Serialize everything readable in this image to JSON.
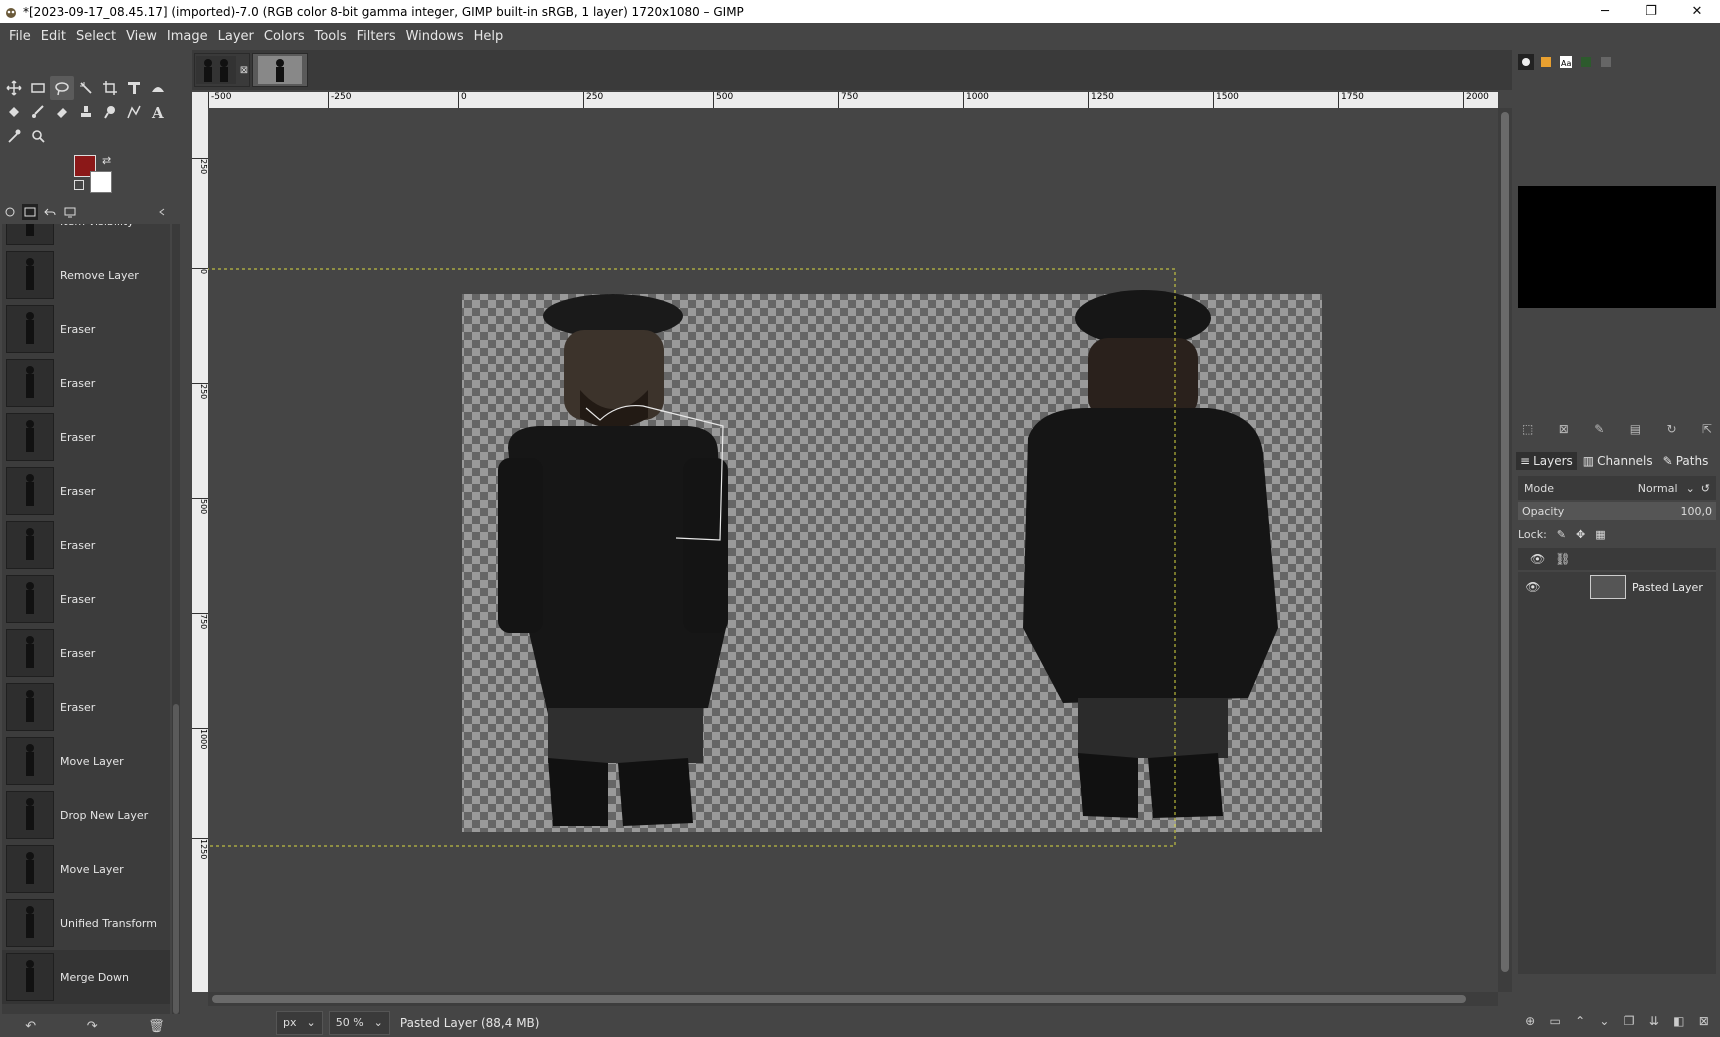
{
  "window": {
    "title": "*[2023-09-17_08.45.17] (imported)-7.0 (RGB color 8-bit gamma integer, GIMP built-in sRGB, 1 layer) 1720x1080 – GIMP",
    "minimize": "─",
    "maximize": "❐",
    "close": "✕"
  },
  "menu": [
    "File",
    "Edit",
    "Select",
    "View",
    "Image",
    "Layer",
    "Colors",
    "Tools",
    "Filters",
    "Windows",
    "Help"
  ],
  "toolbox": {
    "foreground_color": "#8b1818",
    "background_color": "#ffffff",
    "tools": [
      "move-tool-icon",
      "rect-select-icon",
      "free-select-icon",
      "fuzzy-select-icon",
      "crop-icon",
      "unified-transform-icon",
      "warp-icon",
      "bucket-fill-icon",
      "paintbrush-icon",
      "eraser-icon",
      "clone-icon",
      "smudge-icon",
      "paths-icon",
      "text-icon",
      "color-picker-icon",
      "zoom-icon"
    ]
  },
  "undo_history": [
    {
      "label": "Item visibility"
    },
    {
      "label": "Remove Layer"
    },
    {
      "label": "Eraser"
    },
    {
      "label": "Eraser"
    },
    {
      "label": "Eraser"
    },
    {
      "label": "Eraser"
    },
    {
      "label": "Eraser"
    },
    {
      "label": "Eraser"
    },
    {
      "label": "Eraser"
    },
    {
      "label": "Eraser"
    },
    {
      "label": "Move Layer"
    },
    {
      "label": "Drop New Layer"
    },
    {
      "label": "Move Layer"
    },
    {
      "label": "Unified Transform"
    },
    {
      "label": "Merge Down"
    }
  ],
  "ruler": {
    "h_ticks": [
      "-500",
      "-250",
      "0",
      "250",
      "500",
      "750",
      "1000",
      "1250",
      "1500",
      "1750",
      "2000"
    ],
    "v_ticks": [
      "250",
      "0",
      "250",
      "500",
      "750",
      "1000",
      "1250"
    ]
  },
  "status": {
    "unit": "px",
    "zoom": "50 %",
    "info": "Pasted Layer (88,4 MB)"
  },
  "layers_panel": {
    "tabs": [
      "Layers",
      "Channels",
      "Paths"
    ],
    "mode_label": "Mode",
    "mode_value": "Normal",
    "opacity_label": "Opacity",
    "opacity_value": "100,0",
    "lock_label": "Lock:",
    "layers": [
      {
        "name": "Pasted Layer",
        "visible": true
      }
    ]
  }
}
